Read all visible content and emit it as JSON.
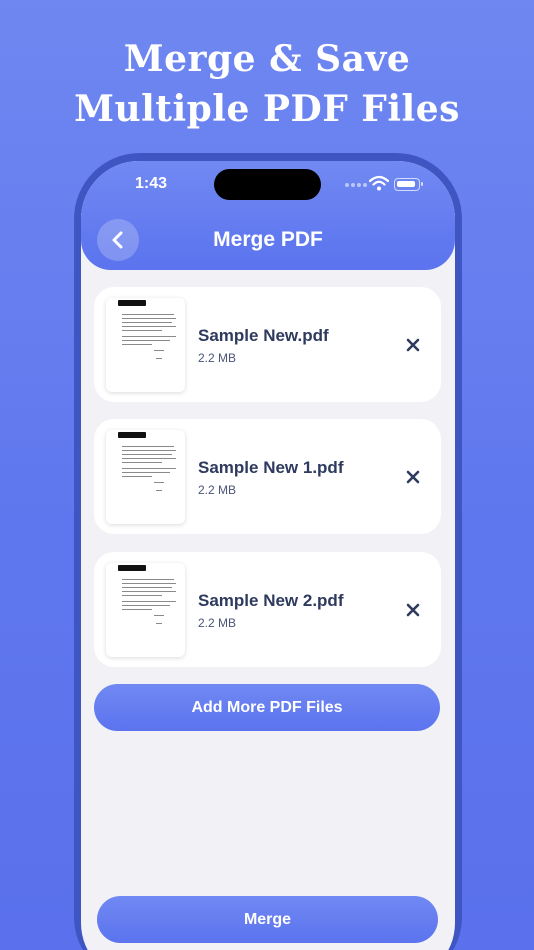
{
  "promo": {
    "line1": "Merge & Save",
    "line2": "Multiple PDF Files"
  },
  "status_bar": {
    "time": "1:43"
  },
  "header": {
    "title": "Merge PDF",
    "back_icon": "chevron-left-icon"
  },
  "files": [
    {
      "name": "Sample New.pdf",
      "size": "2.2 MB",
      "thumb_label": "PREFACE"
    },
    {
      "name": "Sample New 1.pdf",
      "size": "2.2 MB",
      "thumb_label": "PREFACE"
    },
    {
      "name": "Sample New 2.pdf",
      "size": "2.2 MB",
      "thumb_label": "PREFACE"
    }
  ],
  "actions": {
    "add_more_label": "Add More PDF Files",
    "merge_label": "Merge"
  },
  "colors": {
    "accent": "#5b73ee",
    "background": "#6f87f0",
    "text_dark": "#2e3a5e",
    "screen_bg": "#f2f2f6"
  }
}
